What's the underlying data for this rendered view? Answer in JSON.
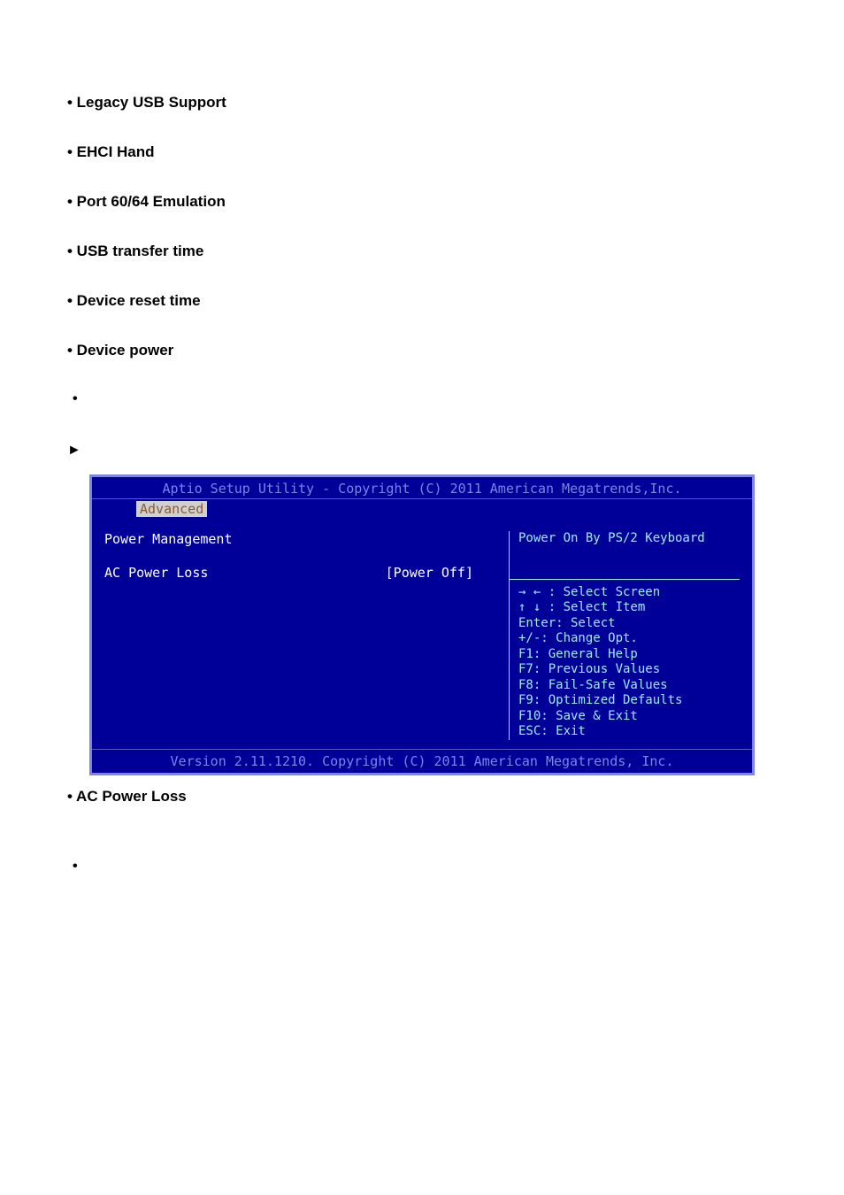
{
  "top_comma": ",",
  "bullets": [
    "• Legacy USB Support",
    "• EHCI Hand",
    "• Port 60/64 Emulation",
    "• USB transfer time",
    "• Device reset time",
    "• Device power"
  ],
  "small_dot": "•",
  "triangle": "►",
  "bios": {
    "header": "Aptio Setup Utility - Copyright (C) 2011 American Megatrends,Inc.",
    "tab": "Advanced",
    "pm_title": "Power Management",
    "pm_label": "AC Power Loss",
    "pm_value": "[Power Off]",
    "help_title": "Power On By PS/2 Keyboard",
    "help_lines": [
      "→ ← : Select Screen",
      "↑ ↓ : Select Item",
      "Enter: Select",
      "+/-:  Change Opt.",
      "F1: General Help",
      "F7: Previous Values",
      "F8: Fail-Safe Values",
      "F9: Optimized Defaults",
      "F10: Save & Exit",
      "ESC: Exit"
    ],
    "footer": "Version 2.11.1210. Copyright (C) 2011 American Megatrends, Inc."
  },
  "after_bullet": "• AC Power Loss",
  "lower_dot": "•",
  "lower_comma": ","
}
